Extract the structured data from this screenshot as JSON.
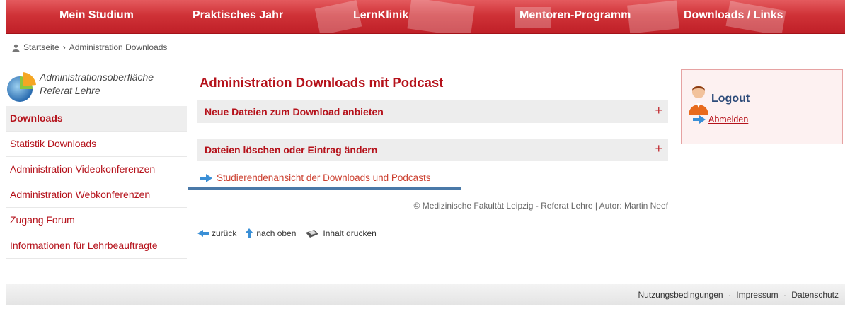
{
  "topnav": {
    "items": [
      "Mein Studium",
      "Praktisches Jahr",
      "LernKlinik",
      "Mentoren-Programm",
      "Downloads / Links"
    ]
  },
  "breadcrumb": {
    "home": "Startseite",
    "separator": "›",
    "current": "Administration Downloads"
  },
  "sidebar": {
    "heading_line1": "Administrationsoberfläche",
    "heading_line2": "Referat Lehre",
    "items": [
      "Downloads",
      "Statistik Downloads",
      "Administration Videokonferenzen",
      "Administration Webkonferenzen",
      "Zugang Forum",
      "Informationen für Lehrbeauftragte"
    ]
  },
  "main": {
    "title": "Administration Downloads mit Podcast",
    "accordion": [
      {
        "label": "Neue Dateien zum Download anbieten",
        "toggle": "+"
      },
      {
        "label": "Dateien löschen oder Eintrag ändern",
        "toggle": "+"
      }
    ],
    "student_view_link": "Studierendenansicht der Downloads und Podcasts",
    "copyright": "© Medizinische Fakultät Leipzig - Referat Lehre | Autor: Martin Neef",
    "tools": {
      "back": "zurück",
      "top": "nach oben",
      "print": "Inhalt drucken"
    }
  },
  "logout": {
    "title": "Logout",
    "link": "Abmelden"
  },
  "footer": {
    "links": [
      "Nutzungsbedingungen",
      "Impressum",
      "Datenschutz"
    ],
    "separator": "·"
  },
  "colors": {
    "brand_red": "#b5121b",
    "nav_red": "#cf3237",
    "link_blue": "#2e4c7a",
    "accent_bar": "#4a79a8"
  }
}
